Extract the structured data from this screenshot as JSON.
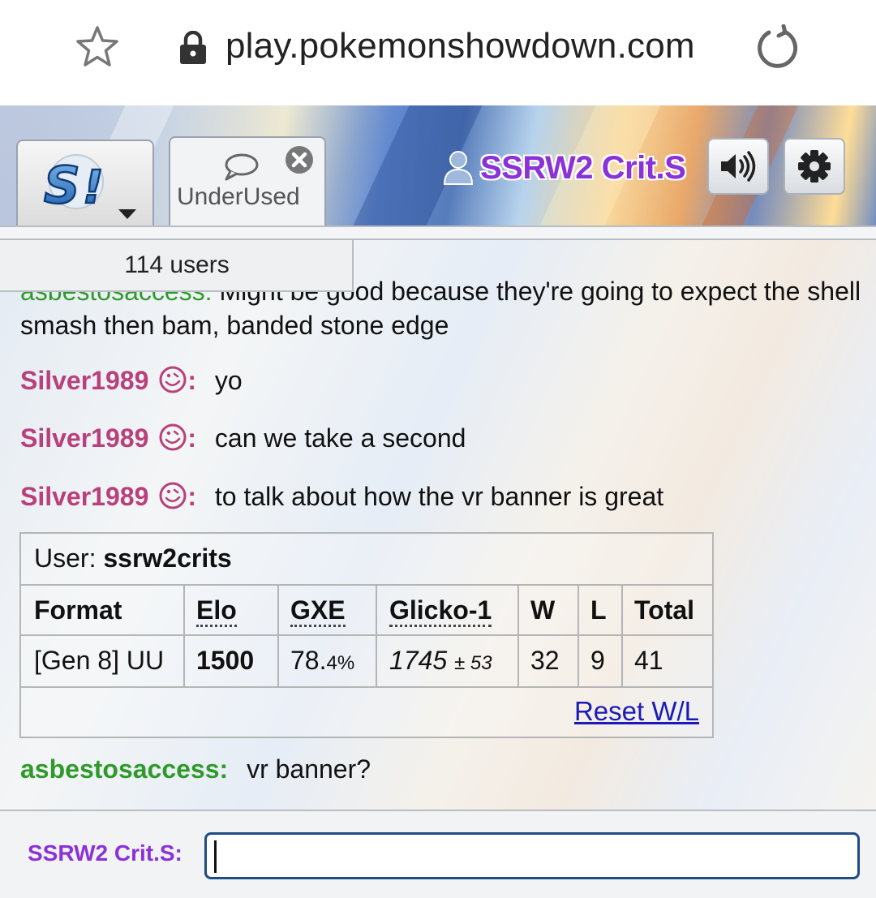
{
  "browser": {
    "url": "play.pokemonshowdown.com"
  },
  "header": {
    "room_tab_label": "UnderUsed",
    "username": "SSRW2 Crit.S",
    "icons": [
      "star-icon",
      "lock-icon",
      "reload-icon",
      "showdown-logo",
      "chevron-down-icon",
      "chat-bubble-icon",
      "close-icon",
      "user-icon",
      "speaker-icon",
      "gear-icon"
    ]
  },
  "users_panel": {
    "count_label": "114 users"
  },
  "messages": [
    {
      "user": "asbestosaccess:",
      "text": "Might be good because they're going to expect the shell smash then bam, banded stone edge",
      "color": "#2f9a2a"
    },
    {
      "user": "Silver1989",
      "colon": ":",
      "text": "yo",
      "color": "#b8407b"
    },
    {
      "user": "Silver1989",
      "colon": ":",
      "text": "can we take a second",
      "color": "#b8407b"
    },
    {
      "user": "Silver1989",
      "colon": ":",
      "text": "to talk about how the vr banner is great",
      "color": "#b8407b"
    },
    {
      "user": "asbestosaccess:",
      "text": "vr banner?",
      "color": "#2f9a2a"
    }
  ],
  "rank_table": {
    "user_label": "User:",
    "user_name": "ssrw2crits",
    "headers": [
      "Format",
      "Elo",
      "GXE",
      "Glicko-1",
      "W",
      "L",
      "Total"
    ],
    "row": {
      "format": "[Gen 8] UU",
      "elo": "1500",
      "gxe_main": "78.",
      "gxe_small": "4%",
      "glicko": "1745",
      "glicko_dev": "± 53",
      "w": "32",
      "l": "9",
      "total": "41"
    },
    "reset_link": "Reset W/L"
  },
  "input": {
    "label": "SSRW2 Crit.S:",
    "value": ""
  },
  "colors": {
    "username_purple": "#8b31d8",
    "green_user": "#2f9a2a",
    "pink_user": "#b8407b",
    "link_blue": "#1a1ab8"
  }
}
